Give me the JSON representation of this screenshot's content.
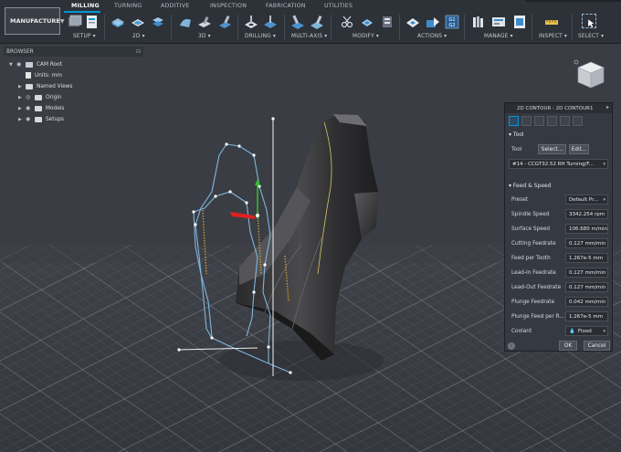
{
  "toolbar": {
    "workspace": "MANUFACTURE",
    "tabs": [
      "MILLING",
      "TURNING",
      "ADDITIVE",
      "INSPECTION",
      "FABRICATION",
      "UTILITIES"
    ],
    "groups": [
      "SETUP",
      "2D",
      "3D",
      "DRILLING",
      "MULTI-AXIS",
      "MODIFY",
      "ACTIONS",
      "MANAGE",
      "INSPECT",
      "SELECT"
    ],
    "icon_text": {
      "g1g2": "G1\nG2"
    }
  },
  "browser": {
    "title": "BROWSER",
    "items": [
      {
        "label": "CAM Root"
      },
      {
        "label": "Units: mm"
      },
      {
        "label": "Named Views"
      },
      {
        "label": "Origin"
      },
      {
        "label": "Models"
      },
      {
        "label": "Setups"
      }
    ]
  },
  "dialog": {
    "title": "2D CONTOUR : 2D CONTOUR1",
    "tool_section": "Tool",
    "tool_label": "Tool",
    "select_btn": "Select...",
    "edit_btn": "Edit...",
    "tool_value": "#14 - CCGT32.52 RH Turning/F...",
    "feed_section": "Feed & Speed",
    "fields": [
      {
        "label": "Preset",
        "value": "Default Pr..."
      },
      {
        "label": "Spindle Speed",
        "value": "3342.254 rpm"
      },
      {
        "label": "Surface Speed",
        "value": "106.680 m/min"
      },
      {
        "label": "Cutting Feedrate",
        "value": "0.127 mm/min"
      },
      {
        "label": "Feed per Tooth",
        "value": "1.267e-5 mm"
      },
      {
        "label": "Lead-In Feedrate",
        "value": "0.127 mm/min"
      },
      {
        "label": "Lead-Out Feedrate",
        "value": "0.127 mm/min"
      },
      {
        "label": "Plunge Feedrate",
        "value": "0.042 mm/min"
      },
      {
        "label": "Plunge Feed per R...",
        "value": "1.267e-5 mm"
      },
      {
        "label": "Coolant",
        "value": "Flood"
      }
    ],
    "ok": "OK",
    "cancel": "Cancel"
  },
  "colors": {
    "accent": "#0696d7",
    "toolpath": "#7fb6dc",
    "grid_line": "#8a8d94",
    "background": "#3a3d44"
  },
  "icons": {
    "close": "close-icon",
    "info": "info-icon",
    "coolant": "droplet-icon",
    "visibility": "eye-icon",
    "expand": "chevron-right-icon",
    "tree_toggle": "chevron-down-icon"
  }
}
